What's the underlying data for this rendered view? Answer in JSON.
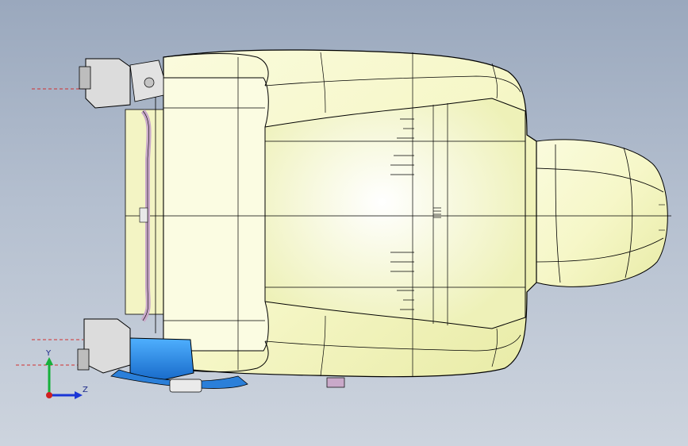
{
  "viewport": {
    "background_top": "#9aa8bd",
    "background_bottom": "#cdd4de"
  },
  "model": {
    "surface_color": "#f7f8cf",
    "surface_shadow": "#e4e79a",
    "edge_color": "#000000",
    "plastic_color": "#2f8ee6",
    "bracket_color": "#dcdcdc",
    "rail_color": "#c9a9c9"
  },
  "triad": {
    "y_label": "Y",
    "z_label": "Z",
    "x_axis_color": "#d11f1f",
    "y_axis_color": "#16b03a",
    "z_axis_color": "#1a36d6"
  }
}
